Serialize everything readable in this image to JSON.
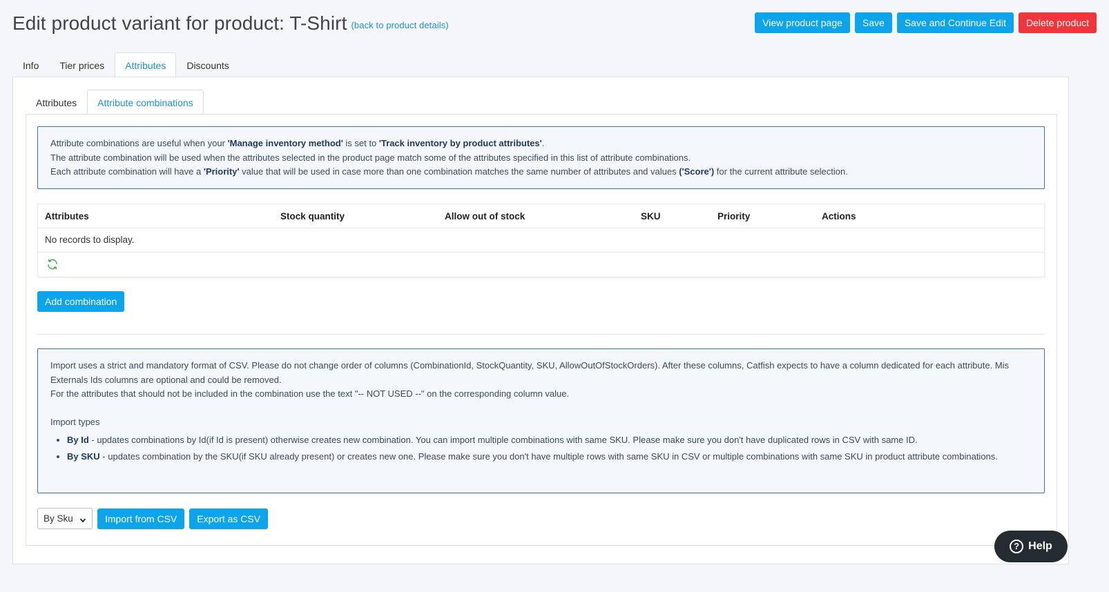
{
  "header": {
    "title": "Edit product variant for product: T-Shirt",
    "back_link": "(back to product details)",
    "buttons": {
      "view_product_page": "View product page",
      "save": "Save",
      "save_continue": "Save and Continue Edit",
      "delete": "Delete product"
    }
  },
  "outer_tabs": [
    "Info",
    "Tier prices",
    "Attributes",
    "Discounts"
  ],
  "inner_tabs": [
    "Attributes",
    "Attribute combinations"
  ],
  "info1": {
    "line1_pre": "Attribute combinations are useful when your ",
    "line1_b1": "'Manage inventory method'",
    "line1_mid": " is set to ",
    "line1_b2": "'Track inventory by product attributes'",
    "line1_end": ".",
    "line2": "The attribute combination will be used when the attributes selected in the product page match some of the attributes specified in this list of attribute combinations.",
    "line3_pre": "Each attribute combination will have a ",
    "line3_b1": "'Priority'",
    "line3_mid": " value that will be used in case more than one combination matches the same number of attributes and values ",
    "line3_b2": "('Score')",
    "line3_end": " for the current attribute selection."
  },
  "grid": {
    "columns": [
      "Attributes",
      "Stock quantity",
      "Allow out of stock",
      "SKU",
      "Priority",
      "Actions"
    ],
    "empty_text": "No records to display."
  },
  "add_combination": "Add combination",
  "info2": {
    "para1": "Import uses a strict and mandatory format of CSV. Please do not change order of columns (CombinationId, StockQuantity, SKU, AllowOutOfStockOrders). After these columns, Catfish expects to have a column dedicated for each attribute. Mis Externals Ids columns are optional and could be removed.",
    "para2": "For the attributes that should not be included in the combination use the text \"-- NOT USED --\" on the corresponding column value.",
    "import_types": "Import types",
    "by_id_label": "By Id",
    "by_id_text": " - updates combinations by Id(if Id is present) otherwise creates new combination. You can import multiple combinations with same SKU. Please make sure you don't have duplicated rows in CSV with same ID.",
    "by_sku_label": "By SKU",
    "by_sku_text": " - updates combination by the SKU(if SKU already present) or creates new one. Please make sure you don't have multiple rows with same SKU in CSV or multiple combinations with same SKU in product attribute combinations."
  },
  "import": {
    "select_value": "By Sku",
    "import_button": "Import from CSV",
    "export_button": "Export as CSV"
  },
  "help": {
    "label": "Help",
    "icon": "question-icon"
  },
  "colors": {
    "primary": "#0ca4ea",
    "danger": "#f2353a",
    "link": "#1e90d6",
    "help_bg": "#242b33"
  }
}
